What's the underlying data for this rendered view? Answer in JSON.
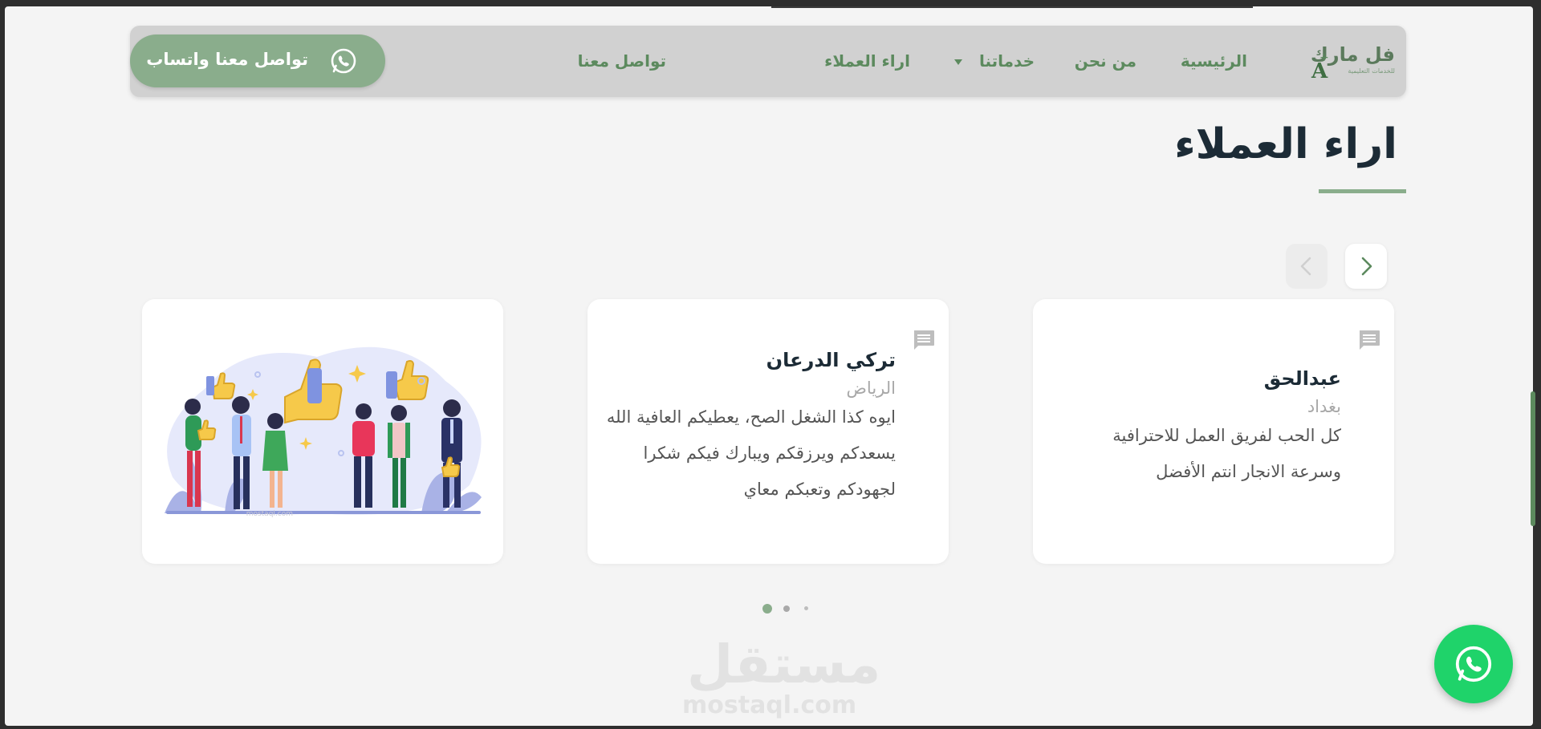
{
  "header": {
    "logo_text": "فل مارك",
    "logo_subtext": "للخدمات التعليمية",
    "logo_letter": "A",
    "nav": [
      {
        "label": "الرئيسية"
      },
      {
        "label": "من نحن"
      },
      {
        "label": "خدماتنا",
        "has_dropdown": true
      },
      {
        "label": "اراء العملاء"
      },
      {
        "label": "تواصل معنا"
      }
    ],
    "whatsapp_button": "تواصل معنا واتساب"
  },
  "section": {
    "title": "اراء العملاء"
  },
  "testimonials": [
    {
      "name": "عبدالحق",
      "city": "بغداد",
      "text": "كل الحب لفريق العمل للاحترافية وسرعة الانجار انتم الأفضل"
    },
    {
      "name": "تركي الدرعان",
      "city": "الرياض",
      "text": "ايوه كذا الشغل الصح، يعطيكم العافية الله يسعدكم ويرزقكم ويبارك فيكم شكرا لجهودكم وتعبكم معاي"
    }
  ],
  "illustration": {
    "icon": "happy-customers-illustration",
    "watermark": "مستقل mostaql.com"
  },
  "carousel": {
    "dots": 3,
    "active_dot": 1
  },
  "watermark": {
    "arabic": "مستقل",
    "latin": "mostaql.com"
  },
  "colors": {
    "accent": "#8aad8c",
    "nav_text": "#5c8a5e",
    "whatsapp_fab": "#1fd36a",
    "heading": "#1c2b36"
  }
}
